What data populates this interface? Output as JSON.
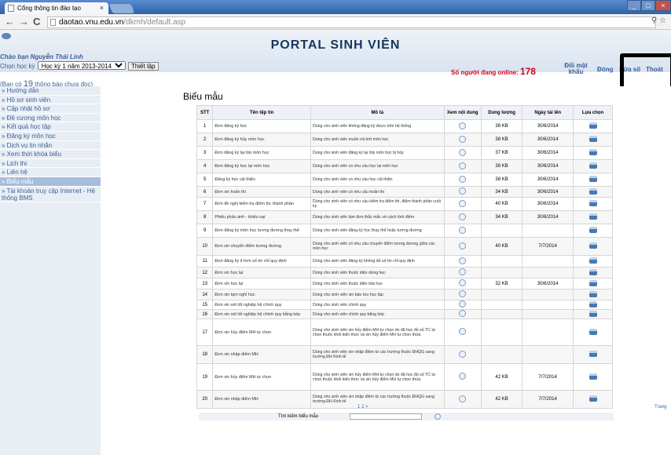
{
  "browser": {
    "tab_title": "Cổng thông tin đào tạo",
    "tab_close": "×",
    "url_domain": "daotao.vnu.edu.vn",
    "url_path": "/dkmh/default.asp",
    "back": "←",
    "forward": "→",
    "reload": "C",
    "zoom_icon": "⚲",
    "star_icon": "☆"
  },
  "header": {
    "title": "PORTAL SINH VIÊN",
    "greeting": "Chào bạn Nguyễn Thái Linh",
    "term_label": "Chọn học kỳ",
    "term_value": "Học kỳ 1 năm 2013-2014",
    "term_button": "Thiết lập",
    "online_label": "Số người đang online:",
    "online_count": "178",
    "links": [
      "Đổi mật khẩu",
      "Đóng",
      "Sửa số",
      "Thoát"
    ],
    "notice_prefix": "(Bạn có",
    "notice_count": "19",
    "notice_suffix": "thông báo chưa đọc)"
  },
  "sidebar": {
    "items": [
      "» Hướng dẫn",
      "» Hồ sơ sinh viên",
      "» Cập nhật hồ sơ",
      "» Đề cương môn học",
      "» Kết quả học tập",
      "» Đăng ký môn học",
      "» Dịch vụ tin nhắn",
      "» Xem thời khóa biểu",
      "» Lịch thi",
      "» Liên hệ",
      "» Biểu mẫu",
      "» Tài khoản truy cập Internet - Hệ thống BMS"
    ]
  },
  "main": {
    "title": "Biểu mẫu",
    "columns": [
      "STT",
      "Tên tệp tin",
      "Mô tả",
      "Xem nội dung",
      "Dung lượng",
      "Ngày tải lên",
      "Lựa chọn"
    ],
    "rows": [
      {
        "stt": "1",
        "name": "Đơn đăng ký học",
        "desc": "Dùng cho sinh viên không đăng ký được trên hệ thống",
        "size": "38 KB",
        "date": "30/6/2014"
      },
      {
        "stt": "2",
        "name": "Đơn đăng ký hủy môn học",
        "desc": "Dùng cho sinh viên muốn rút bớt môn học",
        "size": "38 KB",
        "date": "30/6/2014"
      },
      {
        "stt": "3",
        "name": "Đơn đăng ký lại lớp môn học",
        "desc": "Dùng cho sinh viên đăng ký lại lớp môn học bị hủy",
        "size": "37 KB",
        "date": "30/6/2014"
      },
      {
        "stt": "4",
        "name": "Đơn đăng ký học lại môn học",
        "desc": "Dùng cho sinh viên có nhu cầu học lại môn học",
        "size": "38 KB",
        "date": "30/6/2014"
      },
      {
        "stt": "5",
        "name": "Đăng ký học cải thiện",
        "desc": "Dùng cho sinh viên có nhu cầu học cải thiện",
        "size": "38 KB",
        "date": "30/6/2014"
      },
      {
        "stt": "6",
        "name": "Đơn xin hoãn thi",
        "desc": "Dùng cho sinh viên có nhu cầu hoãn thi",
        "size": "34 KB",
        "date": "30/6/2014"
      },
      {
        "stt": "7",
        "name": "Đơn đề nghị kiểm tra điểm thi, thành phần",
        "desc": "Dùng cho sinh viên có nhu cầu kiểm tra điểm thi, điểm thành phần cuối kỳ",
        "size": "40 KB",
        "date": "30/6/2014"
      },
      {
        "stt": "8",
        "name": "Phiếu phản ánh - khiếu nại",
        "desc": "Dùng cho sinh viên làm đơn thắc mắc về cách tính điểm",
        "size": "34 KB",
        "date": "30/6/2014"
      },
      {
        "stt": "9",
        "name": "Đơn đăng ký môn học tương đương thay thế",
        "desc": "Dùng cho sinh viên đăng ký học thay thế hoặc tương đương",
        "size": "",
        "date": ""
      },
      {
        "stt": "10",
        "name": "Đơn xin chuyển điểm tương đương",
        "desc": "Dùng cho sinh viên có nhu cầu chuyển điểm tương đương giữa các môn học",
        "size": "40 KB",
        "date": "7/7/2014"
      },
      {
        "stt": "11",
        "name": "Đơn đăng ký ít hơn số tín chỉ quy định",
        "desc": "Dùng cho sinh viên đăng ký không đủ số tín chỉ quy định",
        "size": "",
        "date": ""
      },
      {
        "stt": "12",
        "name": "Đơn xin học lại",
        "desc": "Dùng cho sinh viên thuộc diện dừng học",
        "size": "",
        "date": ""
      },
      {
        "stt": "13",
        "name": "Đơn xin học lại",
        "desc": "Dùng cho sinh viên thuộc diện bảo lưu",
        "size": "32 KB",
        "date": "30/6/2014"
      },
      {
        "stt": "14",
        "name": "Đơn xin tạm nghỉ học",
        "desc": "Dùng cho sinh viên xin bảo lưu học tập",
        "size": "",
        "date": ""
      },
      {
        "stt": "15",
        "name": "Đơn xin xét tốt nghiệp hệ chính quy",
        "desc": "Dùng cho sinh viên chính quy",
        "size": "",
        "date": ""
      },
      {
        "stt": "16",
        "name": "Đơn xin xét tốt nghiệp hệ chính quy bằng kép",
        "desc": "Dùng cho sinh viên chính quy bằng kép",
        "size": "",
        "date": ""
      },
      {
        "stt": "17",
        "name": "Đơn xin hủy điểm MH tự chọn",
        "desc": "Dùng cho sinh viên xin hủy điểm MH tự chọn do đã học đủ số TC tự chọn thuộc khối kiến thức và xin hủy điểm MH tự chọn thừa",
        "size": "",
        "date": ""
      },
      {
        "stt": "18",
        "name": "Đơn xin nhập điểm MH",
        "desc": "Dùng cho sinh viên xin nhập điểm từ các trường thuộc ĐHQG sang trường ĐH Kinh tế",
        "size": "",
        "date": ""
      },
      {
        "stt": "19",
        "name": "Đơn xin hủy điểm MH tự chọn",
        "desc": "Dùng cho sinh viên xin hủy điểm MH tự chọn do đã học đủ số TC tự chọn thuộc khối kiến thức và xin hủy điểm MH tự chọn thừa",
        "size": "42 KB",
        "date": "7/7/2014"
      },
      {
        "stt": "20",
        "name": "Đơn xin nhập điểm MH",
        "desc": "Dùng cho sinh viên xin nhập điểm từ các trường thuộc ĐHQG sang trường ĐH Kinh tế",
        "size": "42 KB",
        "date": "7/7/2014"
      }
    ],
    "pager": "1 2 >",
    "trang": "Trang",
    "search_label": "Tìm kiếm biểu mẫu"
  }
}
